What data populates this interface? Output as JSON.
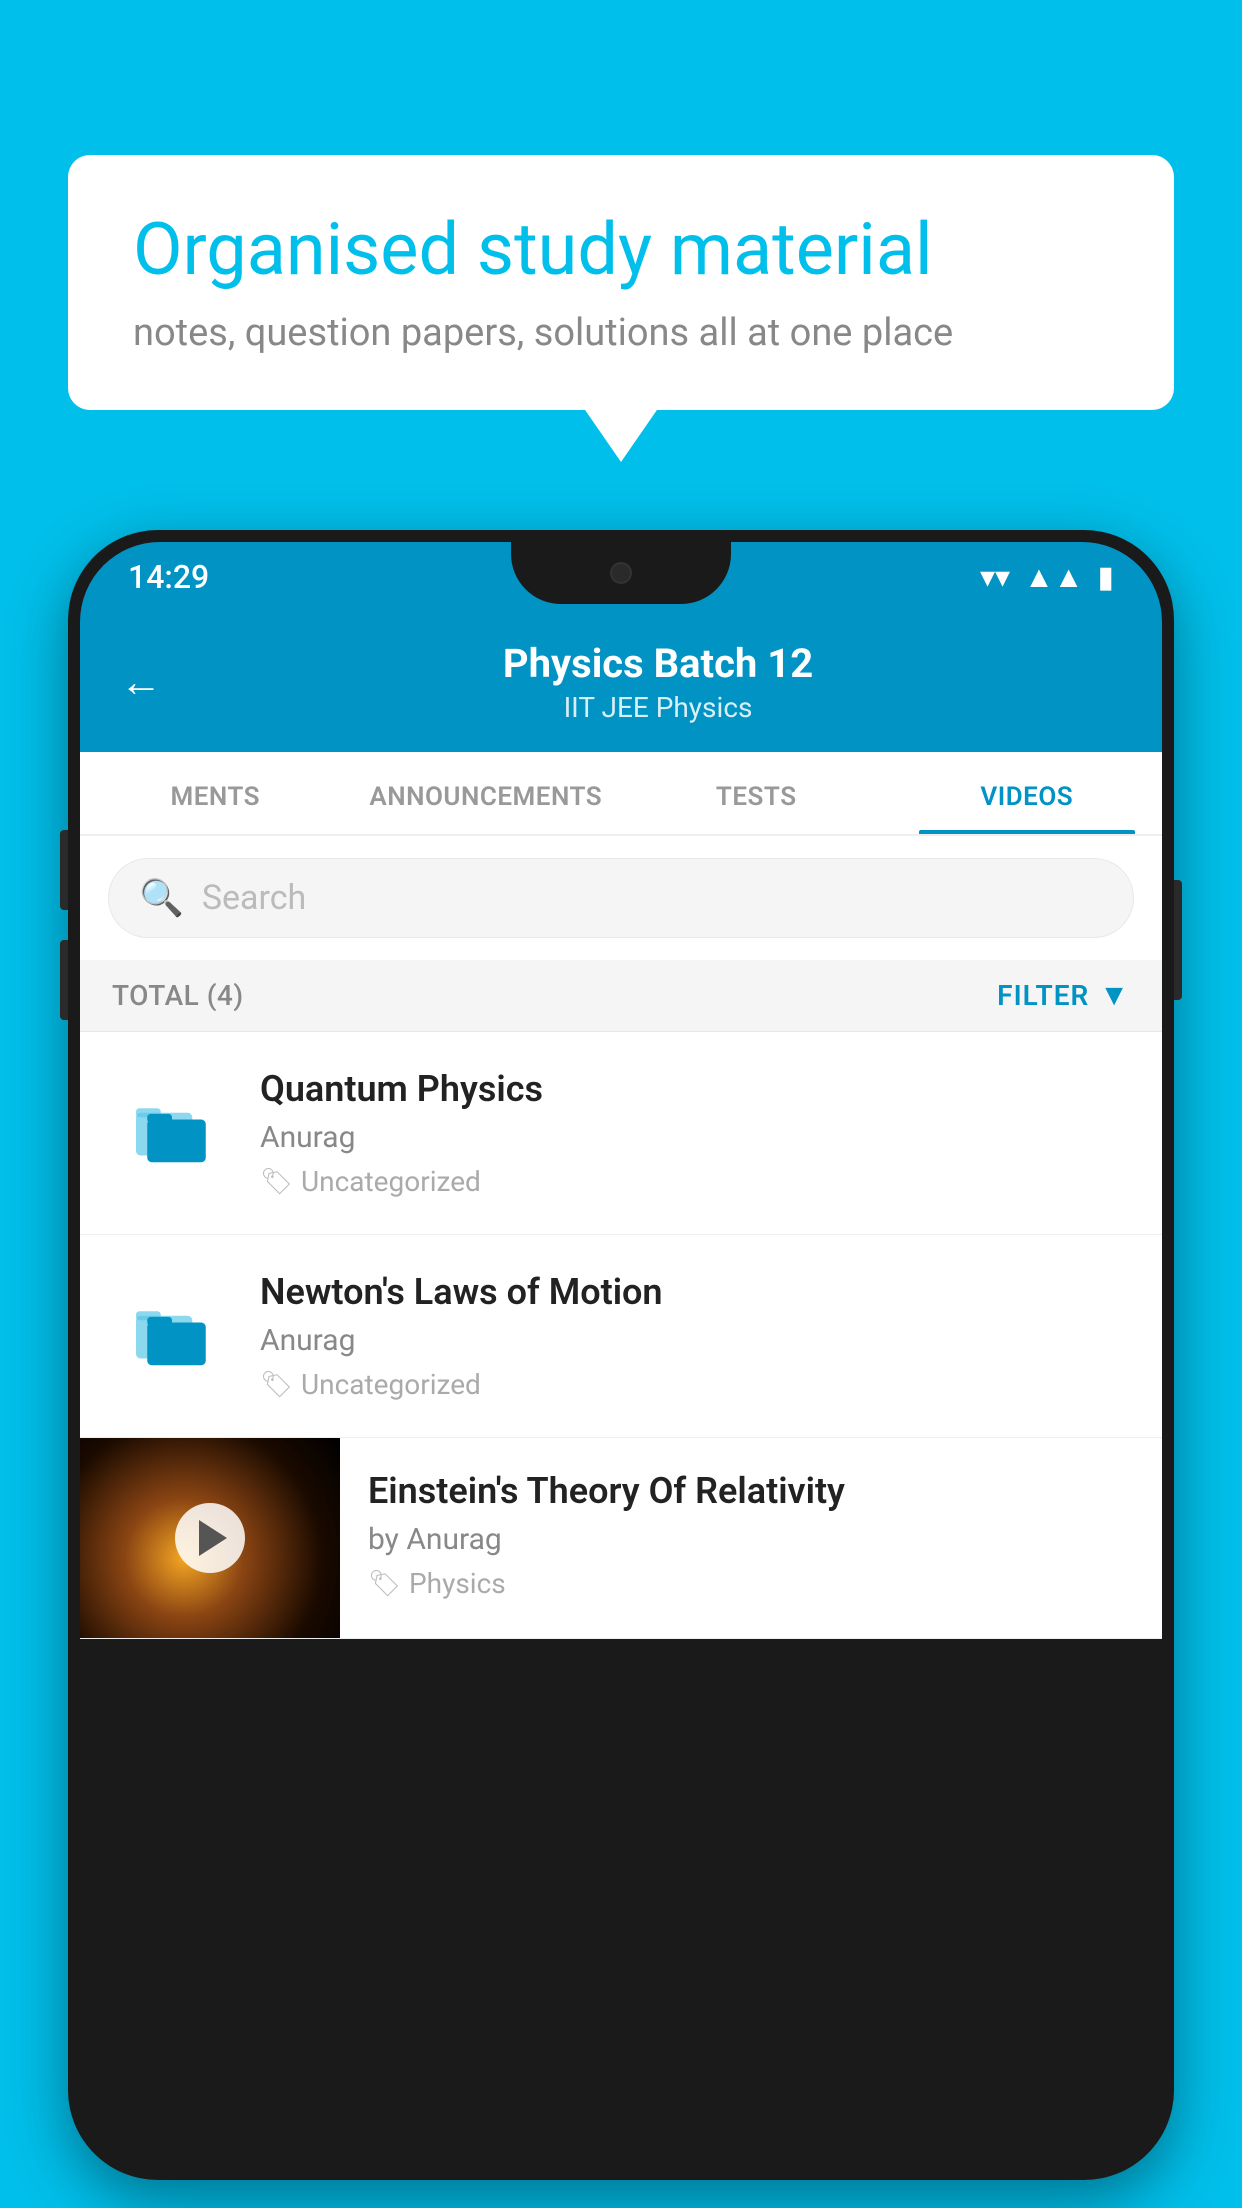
{
  "background": {
    "color": "#00BFEA"
  },
  "speech_bubble": {
    "title": "Organised study material",
    "subtitle": "notes, question papers, solutions all at one place"
  },
  "phone": {
    "status_bar": {
      "time": "14:29"
    },
    "header": {
      "title": "Physics Batch 12",
      "subtitle": "IIT JEE   Physics",
      "back_label": "←"
    },
    "tabs": [
      {
        "label": "MENTS",
        "active": false
      },
      {
        "label": "ANNOUNCEMENTS",
        "active": false
      },
      {
        "label": "TESTS",
        "active": false
      },
      {
        "label": "VIDEOS",
        "active": true
      }
    ],
    "search": {
      "placeholder": "Search"
    },
    "filter_row": {
      "total_label": "TOTAL (4)",
      "filter_label": "FILTER"
    },
    "videos": [
      {
        "id": 1,
        "title": "Quantum Physics",
        "author": "Anurag",
        "tag": "Uncategorized",
        "has_thumbnail": false
      },
      {
        "id": 2,
        "title": "Newton's Laws of Motion",
        "author": "Anurag",
        "tag": "Uncategorized",
        "has_thumbnail": false
      },
      {
        "id": 3,
        "title": "Einstein's Theory Of Relativity",
        "author": "by Anurag",
        "tag": "Physics",
        "has_thumbnail": true
      }
    ]
  }
}
